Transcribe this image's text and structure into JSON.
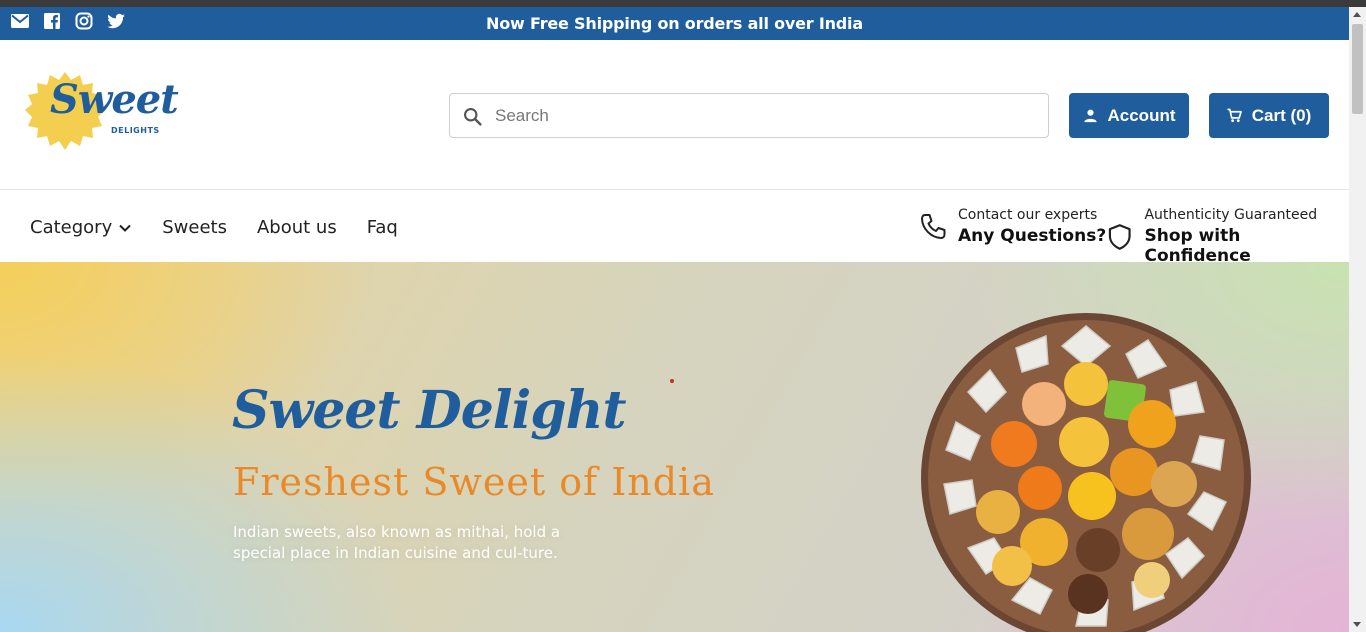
{
  "topbar": {
    "announcement": "Now Free Shipping on orders all over India",
    "social_icons": [
      "mail-icon",
      "facebook-icon",
      "instagram-icon",
      "twitter-icon"
    ],
    "background": "#1f5d9c"
  },
  "header": {
    "logo": {
      "word": "Sweet",
      "sub": "DELIGHTS"
    },
    "search": {
      "placeholder": "Search",
      "value": ""
    },
    "account_label": "Account",
    "cart_label": "Cart (0)"
  },
  "nav": {
    "items": [
      {
        "label": "Category"
      },
      {
        "label": "Sweets"
      },
      {
        "label": "About us"
      },
      {
        "label": "Faq"
      }
    ],
    "contact": {
      "small": "Contact our experts",
      "big": "Any Questions?"
    },
    "authenticity": {
      "small": "Authenticity Guaranteed",
      "big": "Shop with Confidence"
    }
  },
  "hero": {
    "title": "Sweet Delight",
    "tagline": "Freshest Sweet of India",
    "description": "Indian sweets, also known as mithai, hold a special place in Indian cuisine and cul-ture."
  },
  "colors": {
    "brand": "#1f5d9c",
    "accent": "#e88a2a",
    "logo_sun": "#f4cf4f"
  }
}
